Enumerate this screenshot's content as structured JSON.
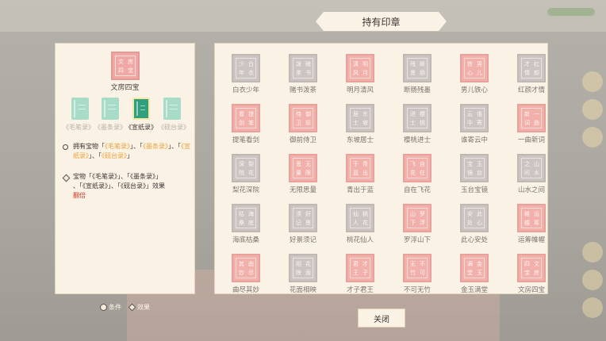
{
  "title": "持有印章",
  "close_label": "关闭",
  "featured": {
    "name": "文房四宝",
    "glyphs": [
      "文",
      "房",
      "四",
      "宝"
    ]
  },
  "books": [
    {
      "label": "《毛笔录》",
      "active": false
    },
    {
      "label": "《墨条录》",
      "active": false
    },
    {
      "label": "《宣纸录》",
      "active": true
    },
    {
      "label": "《砚台录》",
      "active": false
    }
  ],
  "condition": {
    "prefix": "拥有宝物「",
    "items": [
      "《毛笔录》",
      "《墨条录》",
      "《宣纸录》",
      "《砚台录》"
    ]
  },
  "effect": {
    "text_line1": "宝物「《毛笔录》」、「《墨条录》」",
    "text_line2": "、「《宣纸录》」、「《砚台录》」效果",
    "highlight": "翻倍"
  },
  "legend": {
    "condition_label": "条件",
    "effect_label": "效果"
  },
  "seals": [
    {
      "name": "白衣少年",
      "color": "gray",
      "glyphs": [
        "少",
        "白",
        "年",
        "衣"
      ]
    },
    {
      "name": "赌书泼茶",
      "color": "gray",
      "glyphs": [
        "泼",
        "赌",
        "茶",
        "书"
      ]
    },
    {
      "name": "明月清风",
      "color": "pink",
      "glyphs": [
        "清",
        "明",
        "风",
        "月"
      ]
    },
    {
      "name": "断肠残墨",
      "color": "gray",
      "glyphs": [
        "残",
        "断",
        "墨",
        "肠"
      ]
    },
    {
      "name": "男儿铁心",
      "color": "pink",
      "glyphs": [
        "铁",
        "男",
        "心",
        "儿"
      ]
    },
    {
      "name": "红颜才情",
      "color": "gray",
      "glyphs": [
        "才",
        "红",
        "情",
        "颜"
      ]
    },
    {
      "name": "提笔看剑",
      "color": "pink",
      "glyphs": [
        "看",
        "提",
        "剑",
        "笔"
      ]
    },
    {
      "name": "御前侍卫",
      "color": "pink",
      "glyphs": [
        "侍",
        "御",
        "卫",
        "前"
      ]
    },
    {
      "name": "东坡居士",
      "color": "gray",
      "glyphs": [
        "居",
        "东",
        "士",
        "坡"
      ]
    },
    {
      "name": "樱桃进士",
      "color": "gray",
      "glyphs": [
        "进",
        "樱",
        "士",
        "桃"
      ]
    },
    {
      "name": "谁寄云中",
      "color": "gray",
      "glyphs": [
        "云",
        "谁",
        "中",
        "寄"
      ]
    },
    {
      "name": "一曲新词",
      "color": "pink",
      "glyphs": [
        "新",
        "一",
        "词",
        "曲"
      ]
    },
    {
      "name": "梨花深院",
      "color": "gray",
      "glyphs": [
        "深",
        "梨",
        "院",
        "花"
      ]
    },
    {
      "name": "无限思量",
      "color": "pink",
      "glyphs": [
        "思",
        "无",
        "量",
        "限"
      ]
    },
    {
      "name": "青出于蓝",
      "color": "pink",
      "glyphs": [
        "于",
        "青",
        "蓝",
        "出"
      ]
    },
    {
      "name": "自在飞花",
      "color": "pink",
      "glyphs": [
        "飞",
        "自",
        "花",
        "在"
      ]
    },
    {
      "name": "玉台宝镜",
      "color": "gray",
      "glyphs": [
        "宝",
        "玉",
        "镜",
        "台"
      ]
    },
    {
      "name": "山水之间",
      "color": "gray",
      "glyphs": [
        "之",
        "山",
        "间",
        "水"
      ]
    },
    {
      "name": "海底枯桑",
      "color": "gray",
      "glyphs": [
        "枯",
        "海",
        "桑",
        "底"
      ]
    },
    {
      "name": "好景须记",
      "color": "gray",
      "glyphs": [
        "须",
        "好",
        "记",
        "景"
      ]
    },
    {
      "name": "桃花仙人",
      "color": "gray",
      "glyphs": [
        "仙",
        "桃",
        "人",
        "花"
      ]
    },
    {
      "name": "罗浮山下",
      "color": "pink",
      "glyphs": [
        "山",
        "罗",
        "下",
        "浮"
      ]
    },
    {
      "name": "此心安处",
      "color": "gray",
      "glyphs": [
        "安",
        "此",
        "处",
        "心"
      ]
    },
    {
      "name": "运筹帷幄",
      "color": "pink",
      "glyphs": [
        "帷",
        "运",
        "幄",
        "筹"
      ]
    },
    {
      "name": "曲尽其妙",
      "color": "pink",
      "glyphs": [
        "其",
        "曲",
        "妙",
        "尽"
      ]
    },
    {
      "name": "花面相映",
      "color": "gray",
      "glyphs": [
        "相",
        "花",
        "映",
        "面"
      ]
    },
    {
      "name": "才子君王",
      "color": "pink",
      "glyphs": [
        "君",
        "才",
        "王",
        "子"
      ]
    },
    {
      "name": "不可无竹",
      "color": "pink",
      "glyphs": [
        "无",
        "不",
        "竹",
        "可"
      ]
    },
    {
      "name": "金玉满堂",
      "color": "pink",
      "glyphs": [
        "满",
        "金",
        "堂",
        "玉"
      ]
    },
    {
      "name": "文房四宝",
      "color": "pink",
      "glyphs": [
        "四",
        "文",
        "宝",
        "房"
      ]
    }
  ],
  "colors": {
    "panel": "#fbf2e6",
    "seal_pink": "#f2b0aa",
    "seal_gray": "#cbc4c0",
    "book_active": "#2fa07b",
    "highlight": "#e8a23a",
    "effect_red": "#d33b2f"
  }
}
